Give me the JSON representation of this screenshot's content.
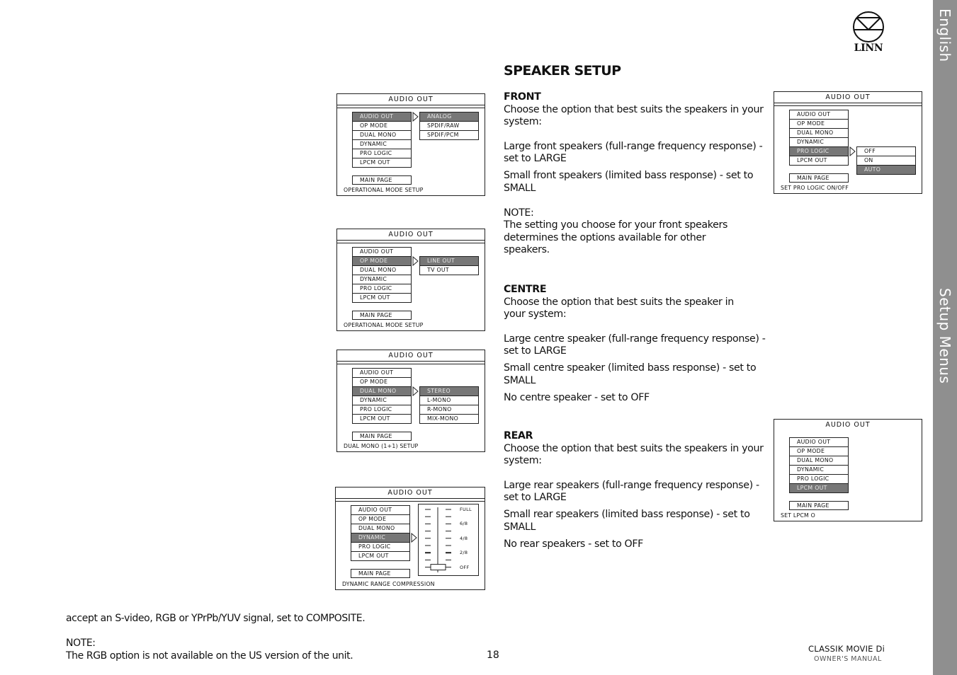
{
  "side_tabs": {
    "top": "English",
    "middle": "Setup Menus"
  },
  "logo": {
    "text": "LINN"
  },
  "colors": {
    "side_tab": "#8f8f8f",
    "menu_highlight": "#777777"
  },
  "page_title": "SPEAKER SETUP",
  "sections": {
    "front": {
      "heading": "FRONT",
      "intro": "Choose the option that best suits the speakers in your system:",
      "options": [
        "Large front speakers (full-range frequency response) - set to LARGE",
        "Small front speakers (limited bass response) - set to SMALL"
      ],
      "note_label": "NOTE:",
      "note_text": "The setting you choose for your front speakers determines the options available for other speakers."
    },
    "centre": {
      "heading": "CENTRE",
      "intro": "Choose the option that best suits the speaker in your system:",
      "options": [
        "Large centre speaker (full-range frequency response) - set to LARGE",
        "Small centre speaker (limited bass response) - set to SMALL",
        "No centre speaker - set to OFF"
      ]
    },
    "rear": {
      "heading": "REAR",
      "intro": "Choose the option that best suits the speakers in your system:",
      "options": [
        "Large rear speakers (full-range frequency response) - set to LARGE",
        "Small rear speakers (limited bass response) - set to SMALL",
        "No rear speakers - set to OFF"
      ]
    }
  },
  "menu_items": [
    "AUDIO OUT",
    "OP MODE",
    "DUAL MONO",
    "DYNAMIC",
    "PRO LOGIC",
    "LPCM OUT"
  ],
  "figures": [
    {
      "title": "AUDIO OUT",
      "selected_index": 0,
      "submenu": [
        "ANALOG",
        "SPDIF/RAW",
        "SPDIF/PCM"
      ],
      "submenu_selected": 0,
      "main_page": "MAIN PAGE",
      "caption": "OPERATIONAL MODE SETUP"
    },
    {
      "title": "AUDIO OUT",
      "selected_index": 1,
      "submenu": [
        "LINE OUT",
        "TV OUT"
      ],
      "submenu_selected": 0,
      "main_page": "MAIN PAGE",
      "caption": "OPERATIONAL MODE SETUP"
    },
    {
      "title": "AUDIO OUT",
      "selected_index": 2,
      "submenu": [
        "STEREO",
        "L-MONO",
        "R-MONO",
        "MIX-MONO"
      ],
      "submenu_selected": 0,
      "main_page": "MAIN PAGE",
      "caption": "DUAL MONO (1+1) SETUP"
    },
    {
      "title": "AUDIO OUT",
      "selected_index": 3,
      "slider_labels": [
        "FULL",
        "6/8",
        "4/8",
        "2/8",
        "OFF"
      ],
      "slider_value": "OFF",
      "main_page": "MAIN PAGE",
      "caption": "DYNAMIC RANGE COMPRESSION"
    },
    {
      "title": "AUDIO OUT",
      "selected_index": 4,
      "submenu": [
        "OFF",
        "ON",
        "AUTO"
      ],
      "submenu_selected": 2,
      "main_page": "MAIN PAGE",
      "caption": "SET PRO LOGIC ON/OFF"
    },
    {
      "title": "AUDIO OUT",
      "selected_index": 5,
      "main_page": "MAIN PAGE",
      "caption": "SET LPCM O"
    }
  ],
  "bottom": {
    "line1": "accept an S-video, RGB or YPrPb/YUV signal, set to COMPOSITE.",
    "note_label": "NOTE:",
    "note_text": "The RGB option is not available on the US version of the unit."
  },
  "page_number": "18",
  "footer": {
    "product": "CLASSIK MOVIE Di",
    "subtitle": "OWNER'S MANUAL"
  }
}
